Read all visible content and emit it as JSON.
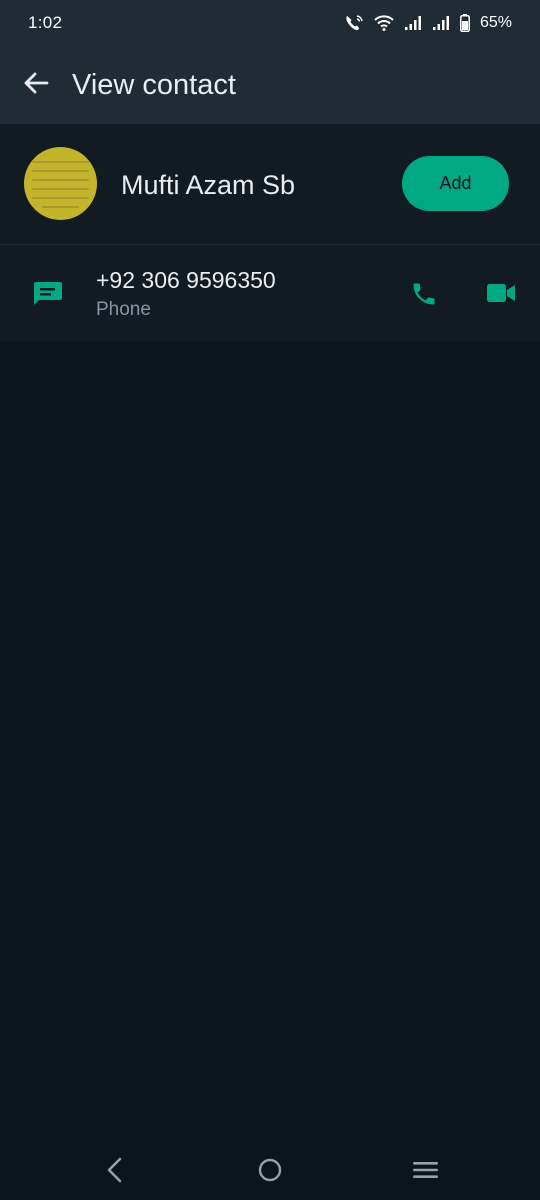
{
  "status_bar": {
    "time": "1:02",
    "battery_percent": "65%",
    "icons": [
      "wifi-call-icon",
      "wifi-icon",
      "signal-icon",
      "signal-icon",
      "battery-icon"
    ]
  },
  "app_bar": {
    "title": "View contact",
    "back_icon": "arrow-left-icon"
  },
  "contact": {
    "name": "Mufti Azam Sb",
    "add_label": "Add",
    "avatar_color": "#c3b52b"
  },
  "phone": {
    "number": "+92 306 9596350",
    "label": "Phone",
    "icons": [
      "message-icon",
      "phone-call-icon",
      "video-call-icon"
    ]
  },
  "nav_bar": {
    "icons": [
      "nav-back-icon",
      "nav-home-icon",
      "nav-menu-icon"
    ]
  },
  "colors": {
    "accent": "#00a884",
    "header_bg": "#1f2c34",
    "background": "#0d151c",
    "panel_bg": "#121b22",
    "secondary_text": "#8696a0"
  }
}
